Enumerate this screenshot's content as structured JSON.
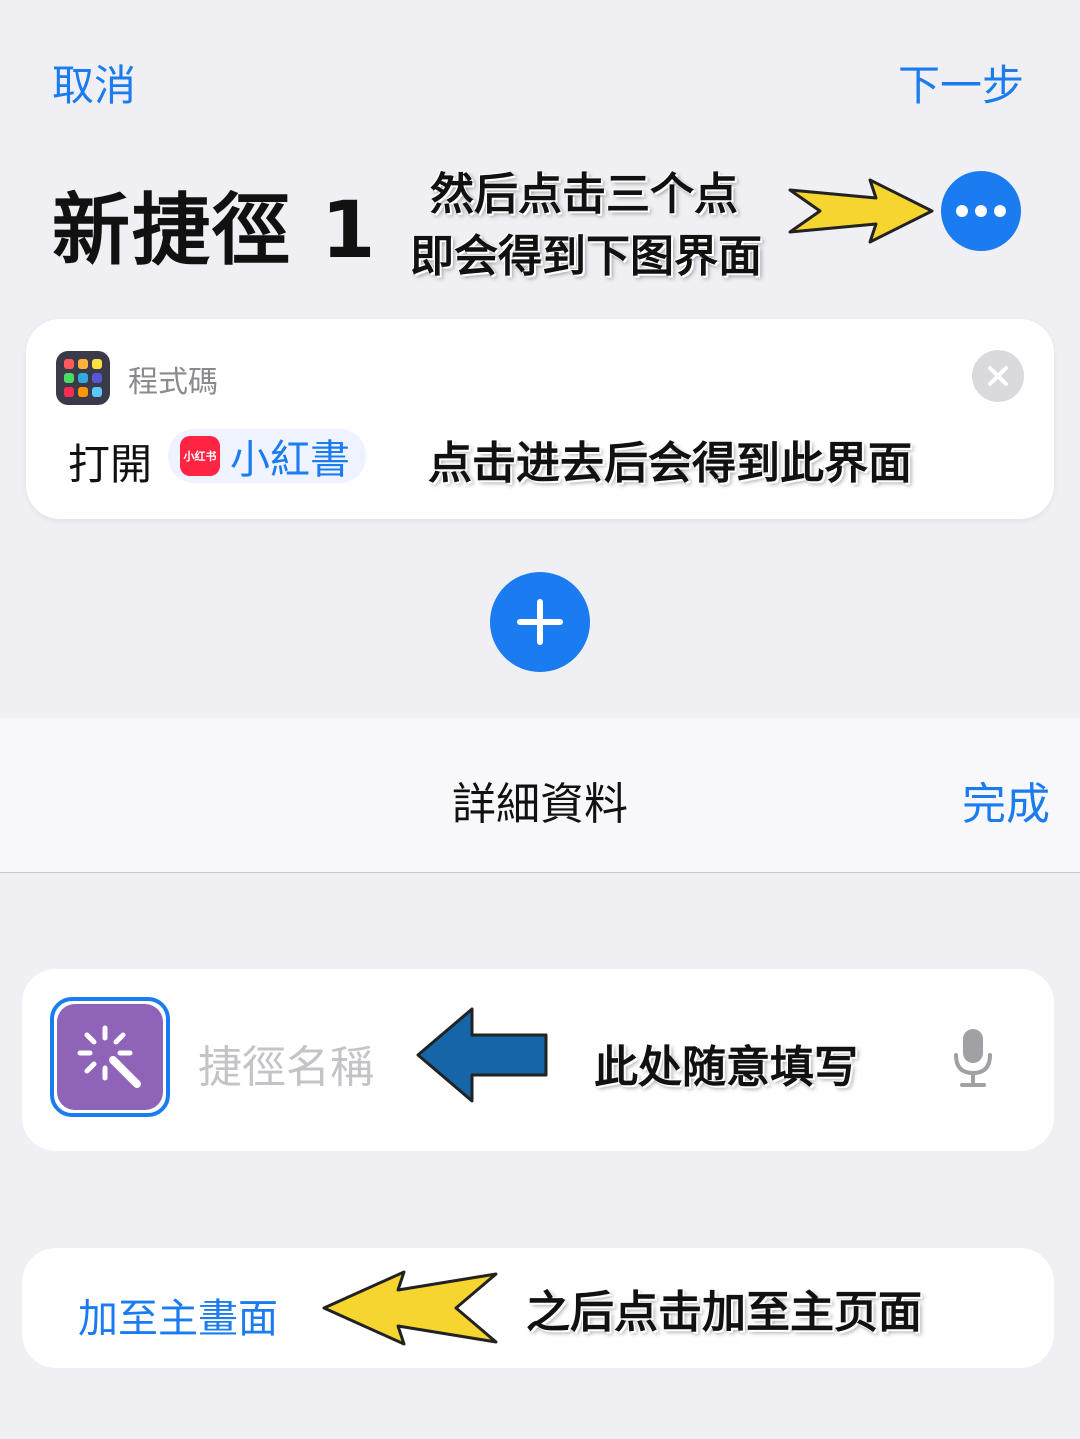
{
  "nav": {
    "cancel_label": "取消",
    "next_label": "下一步"
  },
  "shortcut": {
    "title": "新捷徑 1"
  },
  "annotations": {
    "tap_dots_line1": "然后点击三个点",
    "tap_dots_line2": "即会得到下图界面",
    "tap_into": "点击进去后会得到此界面",
    "fill_freely": "此处随意填写",
    "add_home": "之后点击加至主页面"
  },
  "action_card": {
    "category": "程式碼",
    "verb": "打開",
    "app_icon_text": "小红书",
    "app_name": "小紅書"
  },
  "details_sheet": {
    "title": "詳細資料",
    "done_label": "完成",
    "name_placeholder": "捷徑名稱",
    "add_to_home_label": "加至主畫面"
  },
  "colors": {
    "accent": "#1a7cf0",
    "background": "#efeff4",
    "shortcut_icon": "#8e63b8",
    "xhs_red": "#ff2442",
    "arrow_yellow": "#f7d531",
    "arrow_blue": "#1565a8"
  },
  "icons": {
    "more": "ellipsis-icon",
    "add": "plus-icon",
    "close": "close-icon",
    "category": "scripting-grid-icon",
    "shortcut": "magic-wand-icon",
    "mic": "microphone-icon"
  }
}
